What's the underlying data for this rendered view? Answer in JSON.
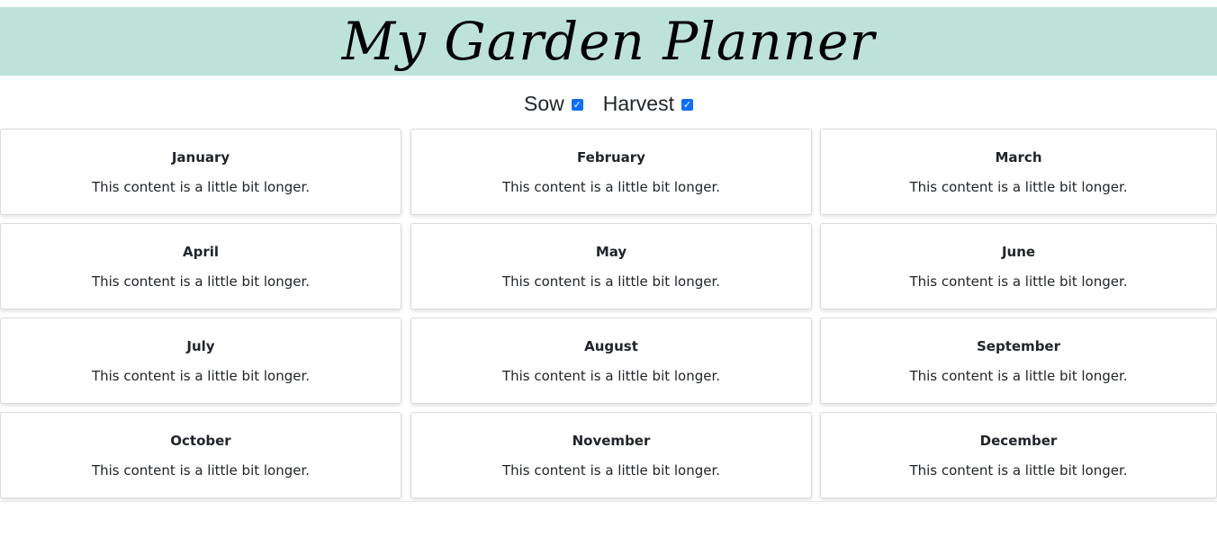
{
  "header": {
    "title": "My Garden Planner",
    "background_color": "#bde3d9"
  },
  "filters": [
    {
      "label": "Sow",
      "checked": true
    },
    {
      "label": "Harvest",
      "checked": true
    }
  ],
  "months": [
    {
      "name": "January",
      "text": "This content is a little bit longer."
    },
    {
      "name": "February",
      "text": "This content is a little bit longer."
    },
    {
      "name": "March",
      "text": "This content is a little bit longer."
    },
    {
      "name": "April",
      "text": "This content is a little bit longer."
    },
    {
      "name": "May",
      "text": "This content is a little bit longer."
    },
    {
      "name": "June",
      "text": "This content is a little bit longer."
    },
    {
      "name": "July",
      "text": "This content is a little bit longer."
    },
    {
      "name": "August",
      "text": "This content is a little bit longer."
    },
    {
      "name": "September",
      "text": "This content is a little bit longer."
    },
    {
      "name": "October",
      "text": "This content is a little bit longer."
    },
    {
      "name": "November",
      "text": "This content is a little bit longer."
    },
    {
      "name": "December",
      "text": "This content is a little bit longer."
    }
  ],
  "colors": {
    "checkbox_accent": "#0d6efd"
  }
}
